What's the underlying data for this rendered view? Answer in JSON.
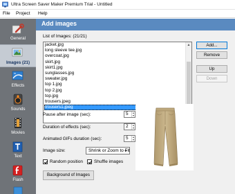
{
  "window": {
    "title": "Ultra Screen Saver Maker Premium Trial - Untitled"
  },
  "menu": {
    "items": [
      "File",
      "Project",
      "Help"
    ]
  },
  "sidebar": {
    "items": [
      {
        "label": "General",
        "icon": "wrench-icon"
      },
      {
        "label": "Images (21)",
        "icon": "photo-icon",
        "active": true
      },
      {
        "label": "Effects",
        "icon": "effects-icon"
      },
      {
        "label": "Sounds",
        "icon": "speaker-icon"
      },
      {
        "label": "Movies",
        "icon": "film-icon"
      },
      {
        "label": "Text",
        "icon": "text-icon"
      },
      {
        "label": "Flash",
        "icon": "flash-icon"
      }
    ]
  },
  "header": {
    "title": "Add images"
  },
  "images": {
    "list_label": "List of Images:  (21/21)",
    "files": [
      "jacket.jpg",
      "long sleeve tee.jpg",
      "overcoat.jpg",
      "skirt.jpg",
      "skirt1.jpg",
      "sunglasses.jpg",
      "sweater.jpg",
      "top 1.jpg",
      "top 2.jpg",
      "top.jpg",
      "trousers.jpeg",
      "trousers1.jpeg"
    ],
    "selected": "trousers1.jpeg",
    "buttons": {
      "add": "Add...",
      "remove": "Remove",
      "up": "Up",
      "down": "Down"
    }
  },
  "settings": {
    "pause_label": "Pause after image (sec):",
    "pause_value": "5",
    "duration_label": "Duration of effects (sec):",
    "duration_value": "2",
    "gif_label": "Animated GIFs duration (sec):",
    "gif_value": "5",
    "size_label": "Image size:",
    "size_value": "Shrink or Zoom to Fit",
    "random_label": "Random position",
    "random_checked": true,
    "shuffle_label": "Shuffle images",
    "shuffle_checked": true,
    "background_button": "Background of Images"
  },
  "colors": {
    "sidebar": "#6f7378",
    "header": "#5a8ac0",
    "selection": "#3399ff"
  }
}
